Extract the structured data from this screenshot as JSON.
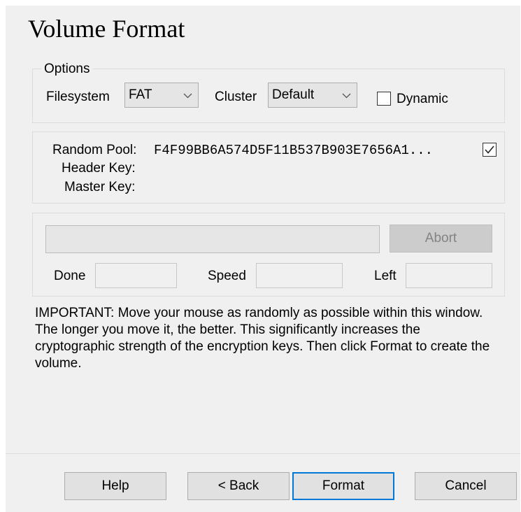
{
  "window": {
    "title": "Volume Format"
  },
  "options": {
    "legend": "Options",
    "filesystem_label": "Filesystem",
    "filesystem_value": "FAT",
    "cluster_label": "Cluster",
    "cluster_value": "Default",
    "dynamic_label": "Dynamic",
    "dynamic_checked": false
  },
  "keys": {
    "random_pool_label": "Random Pool:",
    "random_pool_value": "F4F99BB6A574D5F11B537B903E7656A1...",
    "header_key_label": "Header Key:",
    "master_key_label": "Master Key:",
    "display_pool_checked": true
  },
  "progress": {
    "abort_label": "Abort",
    "done_label": "Done",
    "speed_label": "Speed",
    "left_label": "Left",
    "done_value": "",
    "speed_value": "",
    "left_value": ""
  },
  "important_text": "IMPORTANT: Move your mouse as randomly as possible within this window. The longer you move it, the better. This significantly increases the cryptographic strength of the encryption keys. Then click Format to create the volume.",
  "buttons": {
    "help": "Help",
    "back": "< Back",
    "format": "Format",
    "cancel": "Cancel"
  }
}
